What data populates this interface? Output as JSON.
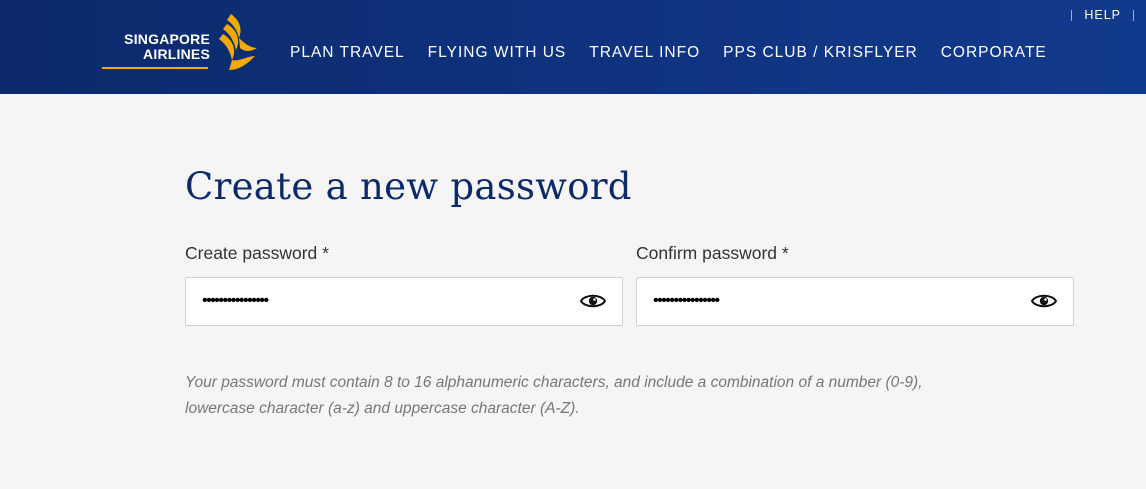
{
  "header": {
    "logo": {
      "line1": "SINGAPORE",
      "line2": "AIRLINES"
    },
    "nav": [
      "PLAN TRAVEL",
      "FLYING WITH US",
      "TRAVEL INFO",
      "PPS CLUB / KRISFLYER",
      "CORPORATE"
    ],
    "utility": {
      "help_label": "HELP"
    },
    "colors": {
      "brand_blue": "#0c2a6b",
      "accent_gold": "#f2a900"
    }
  },
  "form": {
    "title": "Create a new password",
    "create": {
      "label": "Create password *",
      "masked_value": "••••••••••••••••"
    },
    "confirm": {
      "label": "Confirm password *",
      "masked_value": "••••••••••••••••"
    },
    "eye_icon": "eye-icon",
    "hint_line1": "Your password must contain 8 to 16 alphanumeric characters, and include a combination of a number (0-9),",
    "hint_line2": "lowercase character (a-z) and uppercase character (A-Z)."
  }
}
